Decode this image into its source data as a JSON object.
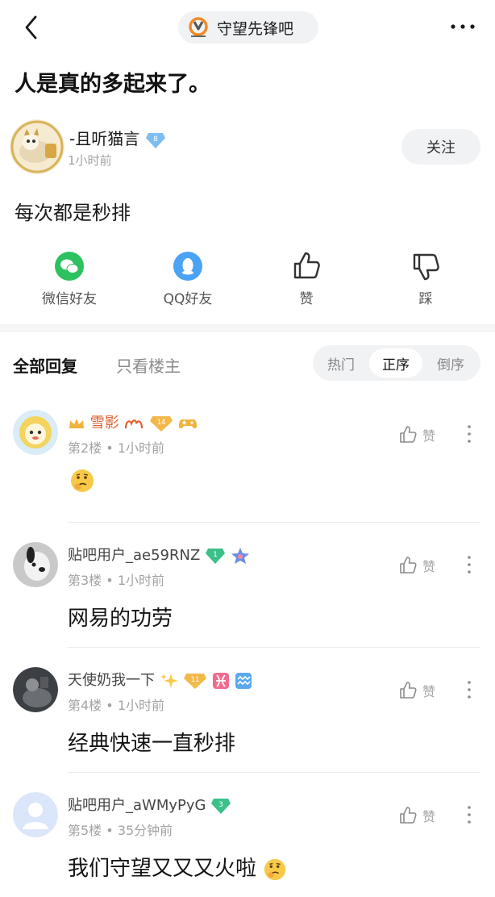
{
  "header": {
    "forum_name": "守望先锋吧",
    "post_title": "人是真的多起来了。"
  },
  "author": {
    "name": "-且听猫言",
    "level": "8",
    "time": "1小时前",
    "follow_label": "关注",
    "post_body": "每次都是秒排"
  },
  "actions": {
    "wechat_label": "微信好友",
    "qq_label": "QQ好友",
    "like_label": "赞",
    "dislike_label": "踩"
  },
  "reply_tabs": {
    "all_label": "全部回复",
    "host_only_label": "只看楼主",
    "sort_hot": "热门",
    "sort_asc": "正序",
    "sort_desc": "倒序",
    "active_sort": "正序"
  },
  "replies": [
    {
      "name": "雪影",
      "level": "14",
      "floor": "第2楼",
      "time": "1小时前",
      "text": "",
      "like_label": "赞"
    },
    {
      "name": "贴吧用户_ae59RNZ",
      "level": "1",
      "floor": "第3楼",
      "time": "1小时前",
      "text": "网易的功劳",
      "like_label": "赞"
    },
    {
      "name": "天使奶我一下",
      "level": "11",
      "floor": "第4楼",
      "time": "1小时前",
      "text": "经典快速一直秒排",
      "like_label": "赞"
    },
    {
      "name": "贴吧用户_aWMyPyG",
      "level": "3",
      "floor": "第5楼",
      "time": "35分钟前",
      "text": "我们守望又又又火啦",
      "like_label": "赞"
    }
  ],
  "separator": "•",
  "colors": {
    "accent_vip_name": "#e0602f",
    "level_badge": "#5aa9f0",
    "green_badge": "#3cc08a",
    "wechat": "#2dc15f",
    "qq": "#4aa3f5"
  }
}
